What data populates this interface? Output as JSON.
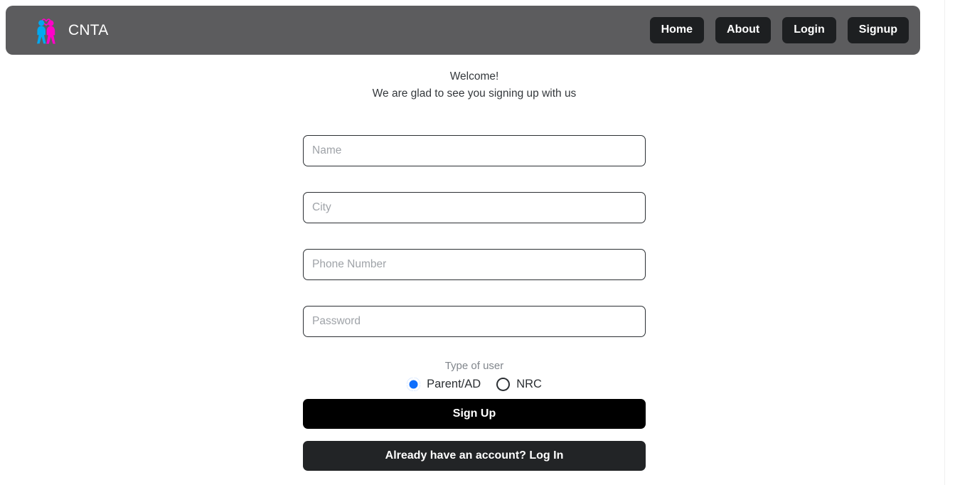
{
  "header": {
    "brand_name": "CNTA",
    "brand_logo_icon": "two-people-logo-icon",
    "background_color": "#5c5c5e",
    "nav": [
      {
        "label": "Home",
        "name": "nav-home"
      },
      {
        "label": "About",
        "name": "nav-about"
      },
      {
        "label": "Login",
        "name": "nav-login"
      },
      {
        "label": "Signup",
        "name": "nav-signup"
      }
    ]
  },
  "welcome": {
    "line1": "Welcome!",
    "line2": "We are glad to see you signing up with us"
  },
  "form": {
    "fields": [
      {
        "placeholder": "Name",
        "value": "",
        "type": "text",
        "name": "name-input"
      },
      {
        "placeholder": "City",
        "value": "",
        "type": "text",
        "name": "city-input"
      },
      {
        "placeholder": "Phone Number",
        "value": "",
        "type": "text",
        "name": "phone-number-input"
      },
      {
        "placeholder": "Password",
        "value": "",
        "type": "password",
        "name": "password-input"
      }
    ],
    "user_type": {
      "label": "Type of user",
      "selected": "Parent/AD",
      "accent_color": "#0d6efd",
      "options": [
        {
          "label": "Parent/AD",
          "checked": true
        },
        {
          "label": "NRC",
          "checked": false
        }
      ]
    },
    "submit_label": "Sign Up",
    "login_label": "Already have an account? Log In",
    "submit_color": "#000000",
    "login_color": "#222426"
  }
}
